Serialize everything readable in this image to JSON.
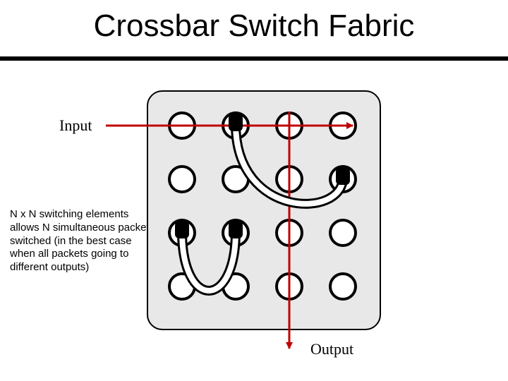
{
  "title": "Crossbar Switch Fabric",
  "labels": {
    "input": "Input",
    "output": "Output"
  },
  "description": "N x N switching elements allows N simultaneous packets switched (in the best case when all packets going to different outputs)",
  "diagram": {
    "grid": {
      "rows": 4,
      "cols": 4
    },
    "connected_nodes": [
      {
        "row": 0,
        "col": 1
      },
      {
        "row": 1,
        "col": 3
      },
      {
        "row": 2,
        "col": 0
      },
      {
        "row": 2,
        "col": 1
      }
    ],
    "arrows": {
      "input_row": 0,
      "output_col": 2
    }
  },
  "colors": {
    "arrow": "#c00000",
    "panel": "#e8e8e8"
  }
}
